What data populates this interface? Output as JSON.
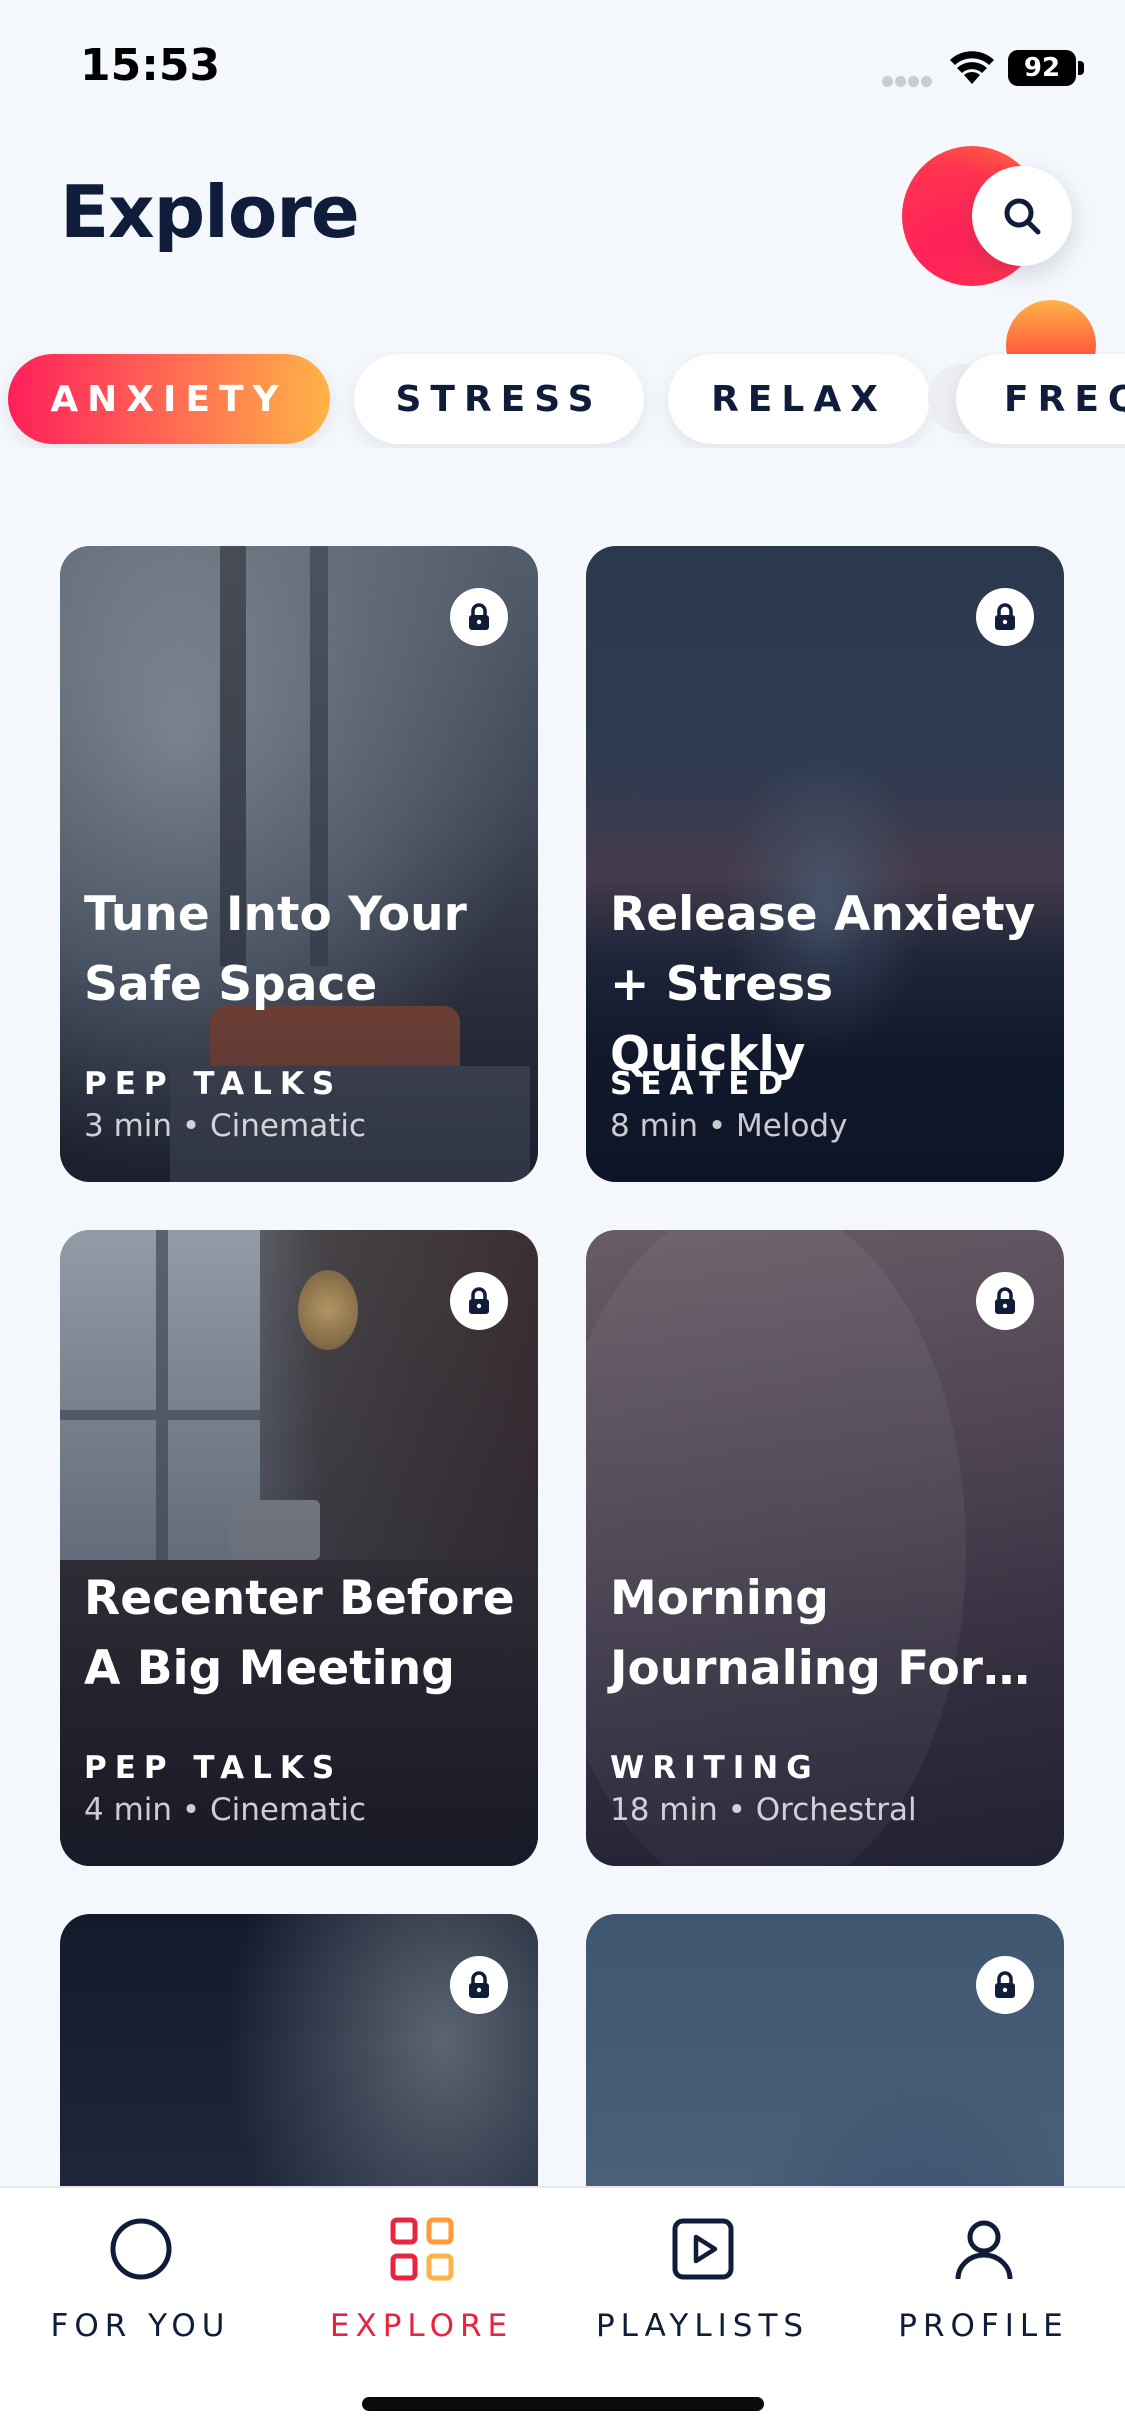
{
  "status_bar": {
    "time": "15:53",
    "battery": "92"
  },
  "header": {
    "title": "Explore"
  },
  "categories": [
    {
      "label": "ANXIETY",
      "active": true
    },
    {
      "label": "STRESS",
      "active": false
    },
    {
      "label": "RELAX",
      "active": false
    },
    {
      "label": "FREQ",
      "active": false
    }
  ],
  "cards": [
    {
      "title": "Tune Into Your Safe Space",
      "category": "PEP TALKS",
      "meta": "3 min • Cinematic",
      "locked": true
    },
    {
      "title": "Release Anxiety + Stress Quickly",
      "category": "SEATED",
      "meta": "8 min • Melody",
      "locked": true
    },
    {
      "title": "Recenter Before A Big Meeting",
      "category": "PEP TALKS",
      "meta": "4 min • Cinematic",
      "locked": true
    },
    {
      "title": "Morning Journaling For…",
      "category": "WRITING",
      "meta": "18 min • Orchestral",
      "locked": true
    },
    {
      "title": "",
      "category": "",
      "meta": "",
      "locked": true
    },
    {
      "title": "",
      "category": "",
      "meta": "",
      "locked": true
    }
  ],
  "tabs": [
    {
      "label": "FOR YOU",
      "icon": "circle-icon",
      "active": false
    },
    {
      "label": "EXPLORE",
      "icon": "grid-icon",
      "active": true
    },
    {
      "label": "PLAYLISTS",
      "icon": "play-square-icon",
      "active": false
    },
    {
      "label": "PROFILE",
      "icon": "person-icon",
      "active": false
    }
  ],
  "colors": {
    "accent_red": "#e8243f",
    "gradient_start": "#ff1f5a",
    "gradient_end": "#ffb347",
    "text_dark": "#0f1c3a",
    "background": "#f4f7fb"
  }
}
